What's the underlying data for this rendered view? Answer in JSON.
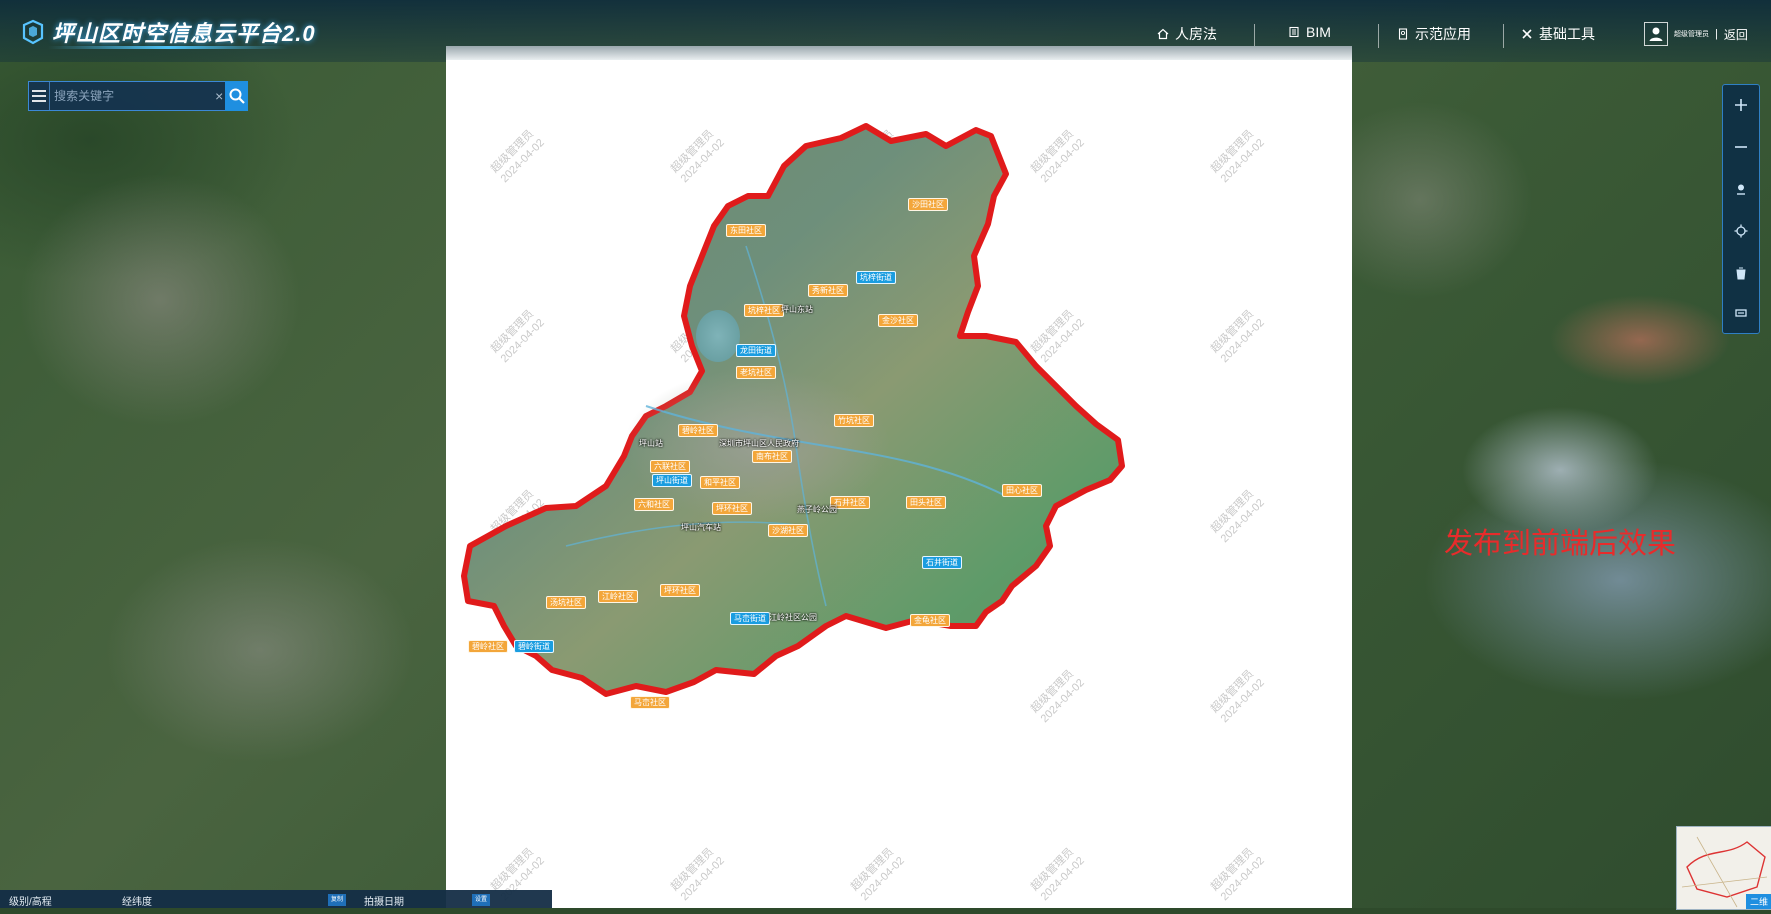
{
  "app": {
    "title": "坪山区时空信息云平台2.0"
  },
  "nav": {
    "items": [
      {
        "label": "人房法",
        "icon": "home-icon"
      },
      {
        "label": "BIM",
        "icon": "building-icon"
      },
      {
        "label": "示范应用",
        "icon": "document-icon"
      },
      {
        "label": "基础工具",
        "icon": "tools-icon"
      }
    ]
  },
  "user": {
    "name": "超级管理员",
    "separator": "|",
    "back_label": "返回"
  },
  "search": {
    "placeholder": "搜索关键字",
    "clear": "×"
  },
  "map": {
    "overlay_text": "发布到前端后效果",
    "watermark_user": "超级管理员",
    "watermark_date": "2024-04-02",
    "labels": {
      "l1": "东田社区",
      "l2": "坑梓街道",
      "l3": "沙田社区",
      "l4": "秀新社区",
      "l5": "坑梓社区",
      "l6": "坪山东站",
      "l7": "金沙社区",
      "l8": "龙田街道",
      "l9": "老坑社区",
      "l10": "竹坑社区",
      "l11": "深圳市坪山区人民政府",
      "l12": "碧岭社区",
      "l13": "坪山站",
      "l14": "和平社区",
      "l15": "六联社区",
      "l16": "坪山街道",
      "l17": "南布社区",
      "l18": "坪环社区",
      "l19": "六和社区",
      "l20": "石井社区",
      "l21": "田头社区",
      "l22": "田心社区",
      "l23": "燕子岭公园",
      "l24": "坪山汽车站",
      "l25": "沙湖社区",
      "l26": "石井街道",
      "l27": "汤坑社区",
      "l28": "江岭社区",
      "l29": "坪环社区",
      "l30": "马峦街道",
      "l31": "江岭社区公园",
      "l32": "金龟社区",
      "l33": "碧岭社区",
      "l34": "碧岭街道",
      "l35": "马峦社区"
    }
  },
  "minimap": {
    "button_label": "二维"
  },
  "status": {
    "level_label": "级别/高程",
    "coord_label": "经纬度",
    "copy_tag": "复制",
    "date_label": "拍摄日期",
    "date_tag": "设置"
  },
  "colors": {
    "boundary": "#e01b1b",
    "accent": "#1f8fe0",
    "label_orange": "#f3a63a",
    "label_blue": "#1a9de0",
    "overlay_text": "#e82b2b"
  }
}
